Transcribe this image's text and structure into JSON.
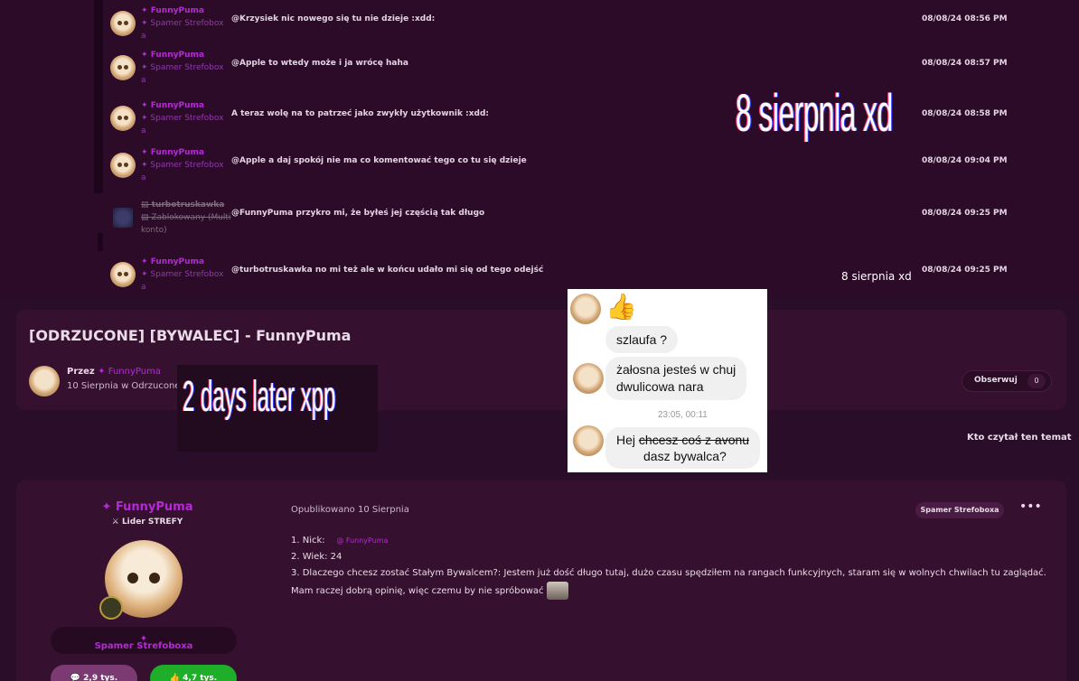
{
  "chat": {
    "messages": [
      {
        "user": "FunnyPuma",
        "role": "Spamer Strefobox",
        "role2": "a",
        "text": "@Krzysiek nic nowego się tu nie dzieje :xdd:",
        "time": "08/08/24 08:56 PM"
      },
      {
        "user": "FunnyPuma",
        "role": "Spamer Strefobox",
        "role2": "a",
        "text": "@Apple to wtedy może i ja wrócę haha",
        "time": "08/08/24 08:57 PM"
      },
      {
        "user": "FunnyPuma",
        "role": "Spamer Strefobox",
        "role2": "a",
        "text": "A teraz wolę na to patrzeć jako zwykły użytkownik :xdd:",
        "time": "08/08/24 08:58 PM"
      },
      {
        "user": "FunnyPuma",
        "role": "Spamer Strefobox",
        "role2": "a",
        "text": "@Apple a daj spokój nie ma co komentować tego co tu się dzieje",
        "time": "08/08/24 09:04 PM"
      },
      {
        "user": "turbotruskawka",
        "role": "Zablokowany (Multi",
        "role2": "konto)",
        "text": "@FunnyPuma przykro mi, że byłeś jej częścią tak długo",
        "time": "08/08/24 09:25 PM"
      },
      {
        "user": "FunnyPuma",
        "role": "Spamer Strefobox",
        "role2": "a",
        "text": "@turbotruskawka no mi też ale w końcu udało mi się od tego odejść",
        "time": "08/08/24 09:25 PM"
      }
    ]
  },
  "overlays": {
    "big": "8 sierpnia xd",
    "small": "8 sierpnia xd",
    "mid": "2 days later xpp"
  },
  "topic": {
    "title": "[ODRZUCONE] [BYWALEC] - FunnyPuma",
    "by_label": "Przez",
    "by_user": "FunnyPuma",
    "date": "10 Sierpnia w Odrzucone",
    "follow_label": "Obserwuj",
    "follow_count": "0",
    "readers": "Kto czytał ten temat"
  },
  "messenger": {
    "msg1": "szlaufa ?",
    "msg2a": "żałosna jesteś w chuj",
    "msg2b": "dwulicowa nara",
    "timestamp": "23:05, 00:11",
    "msg3a": "Hej",
    "msg3b": "chcesz coś z avonu",
    "msg3c": "dasz bywalca?"
  },
  "post": {
    "author": "FunnyPuma",
    "rank": "Lider STREFY",
    "group": "Spamer Strefoboxa",
    "stat_a": "2,9 tys.",
    "stat_b": "4,7 tys.",
    "published": "Opublikowano 10 Sierpnia",
    "pill": "Spamer Strefoboxa",
    "more": "•••",
    "line1": "1. Nick:",
    "line1_mention": "@ FunnyPuma",
    "line2": "2. Wiek: 24",
    "line3": "3. Dlaczego chcesz zostać Stałym Bywalcem?: Jestem już dość długo tutaj, dużo czasu spędziłem na rangach funkcyjnych, staram się w wolnych chwilach tu zaglądać. Mam raczej dobrą opinię, więc czemu by nie spróbować"
  }
}
